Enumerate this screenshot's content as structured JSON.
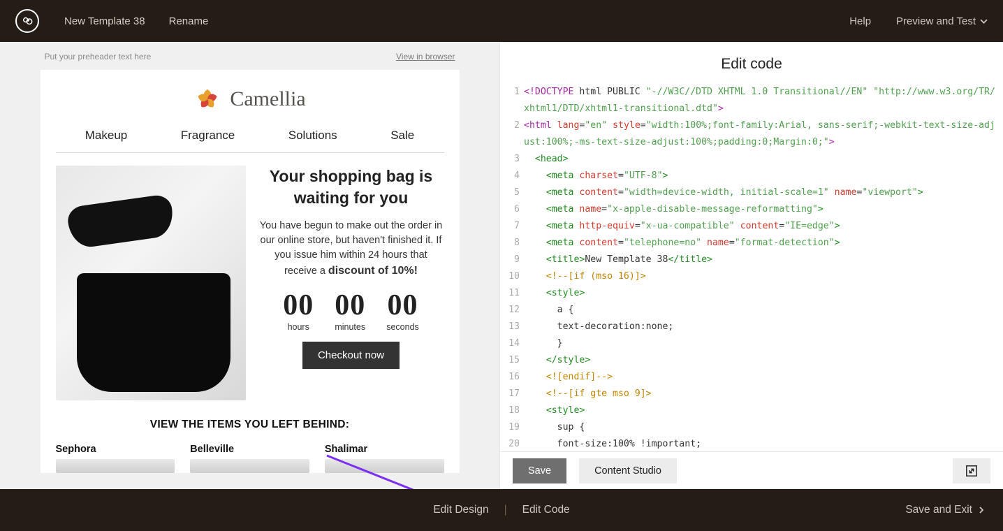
{
  "header": {
    "templateName": "New Template 38",
    "rename": "Rename",
    "help": "Help",
    "previewTest": "Preview and Test"
  },
  "preview": {
    "preheader": "Put your preheader text here",
    "viewInBrowser": "View in browser",
    "brand": "Camellia",
    "nav": [
      "Makeup",
      "Fragrance",
      "Solutions",
      "Sale"
    ],
    "hero": {
      "heading": "Your shopping bag is waiting for you",
      "body": "You have begun to make out the order in our online store, but haven't finished it. If you issue him within 24 hours that receive a ",
      "discount": "discount of 10%!",
      "counts": [
        {
          "big": "00",
          "lbl": "hours"
        },
        {
          "big": "00",
          "lbl": "minutes"
        },
        {
          "big": "00",
          "lbl": "seconds"
        }
      ],
      "cta": "Checkout now"
    },
    "itemsHeading": "VIEW THE ITEMS YOU LEFT BEHIND:",
    "items": [
      "Sephora",
      "Belleville",
      "Shalimar"
    ]
  },
  "editor": {
    "title": "Edit code",
    "buttons": {
      "save": "Save",
      "contentStudio": "Content Studio"
    }
  },
  "codeLines": [
    {
      "n": "1",
      "seg": [
        [
          "pur",
          "<!DOCTYPE"
        ],
        [
          "blk",
          " html PUBLIC "
        ],
        [
          "str",
          "\"-//W3C//DTD XHTML 1.0 Transitional//EN\""
        ],
        [
          "blk",
          " "
        ],
        [
          "str",
          "\"http://www.w3.org/TR/xhtml1/DTD/xhtml1-transitional.dtd\""
        ],
        [
          "pur",
          ">"
        ]
      ]
    },
    {
      "n": "2",
      "seg": [
        [
          "pur",
          "<html "
        ],
        [
          "red",
          "lang"
        ],
        [
          "blk",
          "="
        ],
        [
          "str",
          "\"en\""
        ],
        [
          "blk",
          " "
        ],
        [
          "red",
          "style"
        ],
        [
          "blk",
          "="
        ],
        [
          "str",
          "\"width:100%;font-family:Arial, sans-serif;-webkit-text-size-adjust:100%;-ms-text-size-adjust:100%;padding:0;Margin:0;\""
        ],
        [
          "pur",
          ">"
        ]
      ]
    },
    {
      "n": "3",
      "seg": [
        [
          "blk",
          "  "
        ],
        [
          "grn",
          "<head>"
        ]
      ]
    },
    {
      "n": "4",
      "seg": [
        [
          "blk",
          "    "
        ],
        [
          "grn",
          "<meta "
        ],
        [
          "red",
          "charset"
        ],
        [
          "blk",
          "="
        ],
        [
          "str",
          "\"UTF-8\""
        ],
        [
          "grn",
          ">"
        ]
      ]
    },
    {
      "n": "5",
      "seg": [
        [
          "blk",
          "    "
        ],
        [
          "grn",
          "<meta "
        ],
        [
          "red",
          "content"
        ],
        [
          "blk",
          "="
        ],
        [
          "str",
          "\"width=device-width, initial-scale=1\""
        ],
        [
          "blk",
          " "
        ],
        [
          "red",
          "name"
        ],
        [
          "blk",
          "="
        ],
        [
          "str",
          "\"viewport\""
        ],
        [
          "grn",
          ">"
        ]
      ]
    },
    {
      "n": "6",
      "seg": [
        [
          "blk",
          "    "
        ],
        [
          "grn",
          "<meta "
        ],
        [
          "red",
          "name"
        ],
        [
          "blk",
          "="
        ],
        [
          "str",
          "\"x-apple-disable-message-reformatting\""
        ],
        [
          "grn",
          ">"
        ]
      ]
    },
    {
      "n": "7",
      "seg": [
        [
          "blk",
          "    "
        ],
        [
          "grn",
          "<meta "
        ],
        [
          "red",
          "http-equiv"
        ],
        [
          "blk",
          "="
        ],
        [
          "str",
          "\"x-ua-compatible\""
        ],
        [
          "blk",
          " "
        ],
        [
          "red",
          "content"
        ],
        [
          "blk",
          "="
        ],
        [
          "str",
          "\"IE=edge\""
        ],
        [
          "grn",
          ">"
        ]
      ]
    },
    {
      "n": "8",
      "seg": [
        [
          "blk",
          "    "
        ],
        [
          "grn",
          "<meta "
        ],
        [
          "red",
          "content"
        ],
        [
          "blk",
          "="
        ],
        [
          "str",
          "\"telephone=no\""
        ],
        [
          "blk",
          " "
        ],
        [
          "red",
          "name"
        ],
        [
          "blk",
          "="
        ],
        [
          "str",
          "\"format-detection\""
        ],
        [
          "grn",
          ">"
        ]
      ]
    },
    {
      "n": "9",
      "seg": [
        [
          "blk",
          "    "
        ],
        [
          "grn",
          "<title>"
        ],
        [
          "blk",
          "New Template 38"
        ],
        [
          "grn",
          "</title>"
        ]
      ]
    },
    {
      "n": "10",
      "seg": [
        [
          "blk",
          "    "
        ],
        [
          "cmt",
          "<!--[if (mso 16)]>"
        ]
      ]
    },
    {
      "n": "11",
      "seg": [
        [
          "blk",
          "    "
        ],
        [
          "grn",
          "<style>"
        ]
      ]
    },
    {
      "n": "12",
      "seg": [
        [
          "blk",
          "      a {"
        ]
      ]
    },
    {
      "n": "13",
      "seg": [
        [
          "blk",
          "      text-decoration:none;"
        ]
      ]
    },
    {
      "n": "14",
      "seg": [
        [
          "blk",
          "      }"
        ]
      ]
    },
    {
      "n": "15",
      "seg": [
        [
          "blk",
          "    "
        ],
        [
          "grn",
          "</style>"
        ]
      ]
    },
    {
      "n": "16",
      "seg": [
        [
          "blk",
          "    "
        ],
        [
          "cmt",
          "<![endif]-->"
        ]
      ]
    },
    {
      "n": "17",
      "seg": [
        [
          "blk",
          "    "
        ],
        [
          "cmt",
          "<!--[if gte mso 9]>"
        ]
      ]
    },
    {
      "n": "18",
      "seg": [
        [
          "blk",
          "    "
        ],
        [
          "grn",
          "<style>"
        ]
      ]
    },
    {
      "n": "19",
      "seg": [
        [
          "blk",
          "      sup {"
        ]
      ]
    },
    {
      "n": "20",
      "seg": [
        [
          "blk",
          "      font-size:100% !important;"
        ]
      ]
    }
  ],
  "footer": {
    "editDesign": "Edit Design",
    "editCode": "Edit Code",
    "saveExit": "Save and Exit"
  }
}
